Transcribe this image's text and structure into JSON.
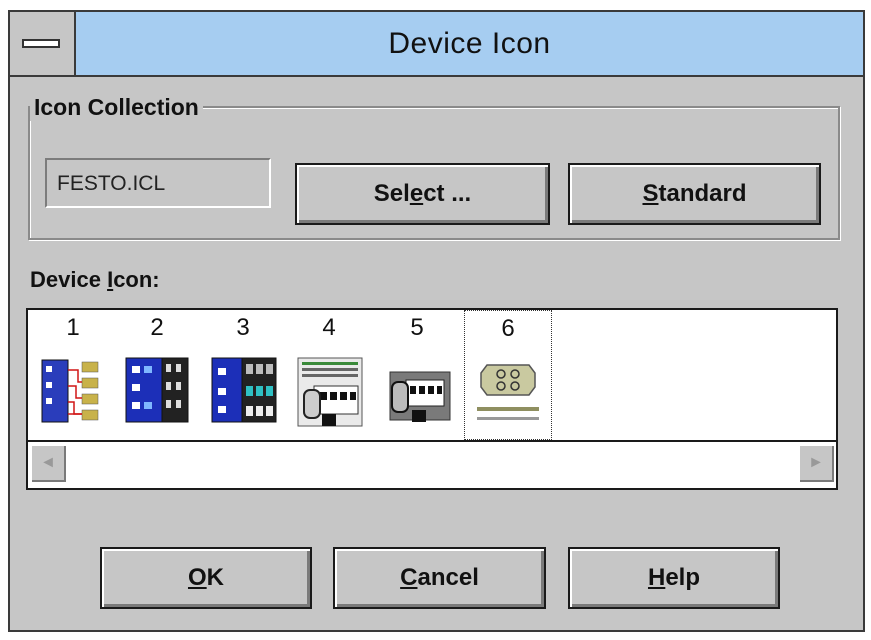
{
  "window": {
    "title": "Device Icon"
  },
  "collection": {
    "group_label": "Icon Collection",
    "file_value": "FESTO.ICL",
    "select_label_pre": "Sel",
    "select_label_ul": "e",
    "select_label_post": "ct ...",
    "standard_label_ul": "S",
    "standard_label_post": "tandard"
  },
  "device": {
    "label_pre": "Device ",
    "label_ul": "I",
    "label_post": "con:",
    "items": [
      {
        "number": "1",
        "icon": "terminal-wiring-icon"
      },
      {
        "number": "2",
        "icon": "blue-controller-module-icon"
      },
      {
        "number": "3",
        "icon": "blue-controller-io-icon"
      },
      {
        "number": "4",
        "icon": "valve-terminal-icon"
      },
      {
        "number": "5",
        "icon": "gray-valve-block-icon"
      },
      {
        "number": "6",
        "icon": "sensor-connector-icon"
      }
    ],
    "selected_number": "6"
  },
  "buttons": {
    "ok_ul": "O",
    "ok_post": "K",
    "cancel_ul": "C",
    "cancel_post": "ancel",
    "help_ul": "H",
    "help_post": "elp"
  },
  "scrollbar": {
    "left_arrow": "◄",
    "right_arrow": "►"
  }
}
